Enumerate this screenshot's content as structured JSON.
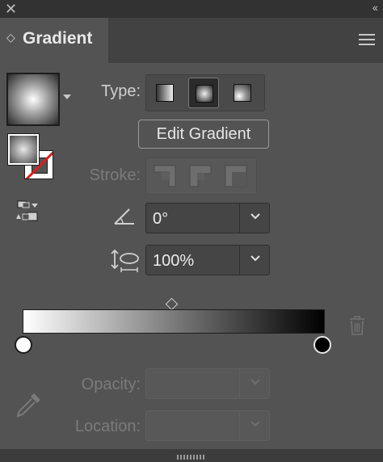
{
  "window": {
    "close_glyph": "✕",
    "collapse_glyph": "‹‹"
  },
  "panel": {
    "title": "Gradient",
    "tab_glyph": "◇"
  },
  "type_section": {
    "label": "Type:",
    "options": [
      "linear-gradient-icon",
      "radial-gradient-icon",
      "freeform-gradient-icon"
    ],
    "selected": "radial"
  },
  "edit_button": "Edit Gradient",
  "stroke_section": {
    "label": "Stroke:",
    "options": [
      "stroke-within-icon",
      "stroke-along-icon",
      "stroke-across-icon"
    ],
    "enabled": false
  },
  "angle": {
    "value": "0°"
  },
  "aspect_ratio": {
    "value": "100%"
  },
  "gradient_slider": {
    "stops": [
      {
        "color": "#ffffff",
        "location": 0
      },
      {
        "color": "#000000",
        "location": 100
      }
    ],
    "midpoint": 50
  },
  "opacity": {
    "label": "Opacity:",
    "value": ""
  },
  "location": {
    "label": "Location:",
    "value": ""
  },
  "colors": {
    "background": "#535353",
    "titlebar": "#323232",
    "stroke_none_red": "#e01c1c"
  }
}
